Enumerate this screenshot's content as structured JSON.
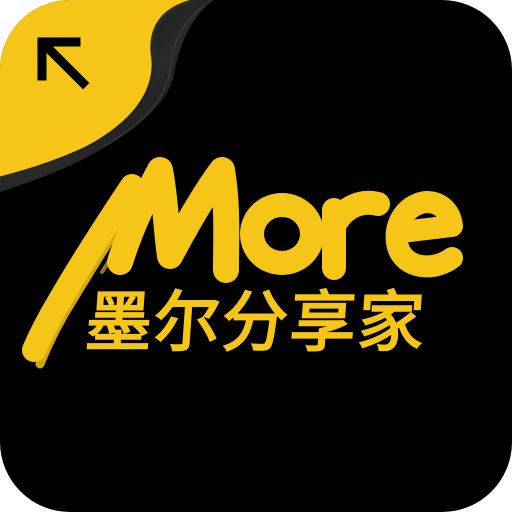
{
  "app_icon": {
    "brand_text": "More",
    "chinese_name": "墨尔分享家",
    "corner_icon": "arrow-up-left-icon",
    "colors": {
      "background": "#000000",
      "accent": "#F5C518",
      "page_curl_shadow": "#1a1a1a"
    }
  }
}
